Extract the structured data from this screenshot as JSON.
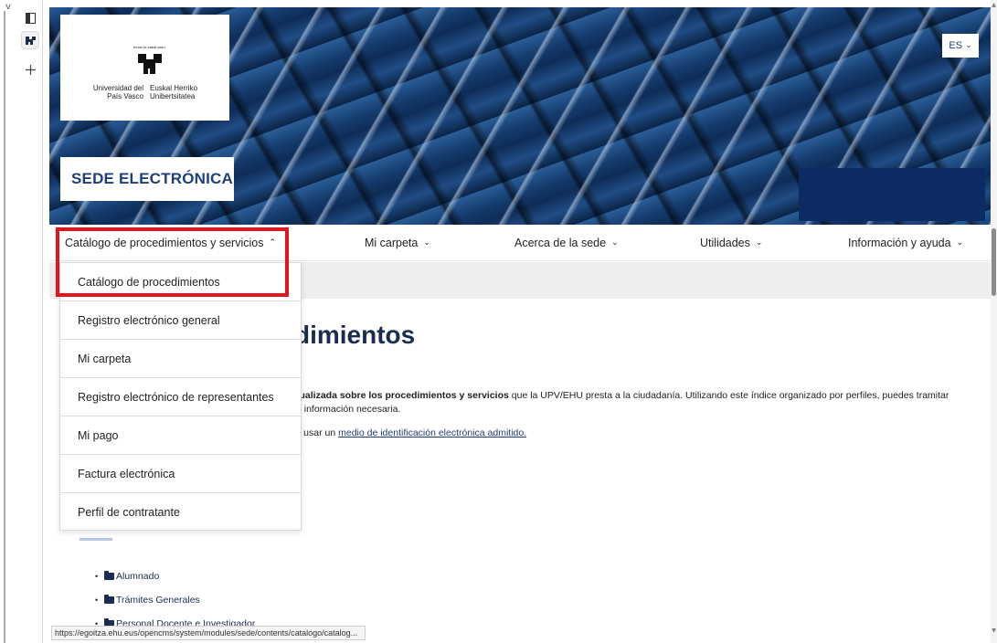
{
  "side_panel": {
    "icons": [
      "sidebar-toggle-icon",
      "ehu-site-icon",
      "plus-icon"
    ],
    "chevron": "v"
  },
  "header": {
    "logo": {
      "tagline": "eman ta zabal zazu",
      "left_text": "Universidad del País Vasco",
      "right_text": "Euskal Herriko Unibertsitatea"
    },
    "site_title": "SEDE ELECTRÓNICA",
    "language": "ES"
  },
  "nav": {
    "items": [
      {
        "label": "Catálogo de procedimientos y servicios",
        "chevron": "up"
      },
      {
        "label": "Mi carpeta",
        "chevron": "down"
      },
      {
        "label": "Acerca de la sede",
        "chevron": "down"
      },
      {
        "label": "Utilidades",
        "chevron": "down"
      },
      {
        "label": "Información y ayuda",
        "chevron": "down"
      }
    ]
  },
  "dropdown": {
    "items": [
      "Catálogo de procedimientos",
      "Registro electrónico general",
      "Mi carpeta",
      "Registro electrónico de representantes",
      "Mi pago",
      "Factura electrónica",
      "Perfil de contratante"
    ]
  },
  "main": {
    "heading": "dimientos",
    "intro_line1_pre": "tualizada sobre los procedimientos y servicios",
    "intro_line1_post": " que la UPV/EHU presta a la ciudadanía. Utilizando este índice organizado por perfiles, puedes tramitar",
    "intro_line2": "a información necesaria.",
    "intro_line3_pre": "s usar un ",
    "intro_link": "medio de identificación electrónica admitido.",
    "profiles": [
      "Alumnado",
      "Trámites Generales",
      "Personal Docente e Investigador"
    ]
  },
  "status_bar": {
    "url": "https://egoitza.ehu.eus/opencms/system/modules/sede/contents/catalogo/catalog..."
  },
  "colors": {
    "brand_navy": "#1f3f7a",
    "highlight_red": "#e3141b",
    "hero_dark_blue": "#0d2b63"
  }
}
